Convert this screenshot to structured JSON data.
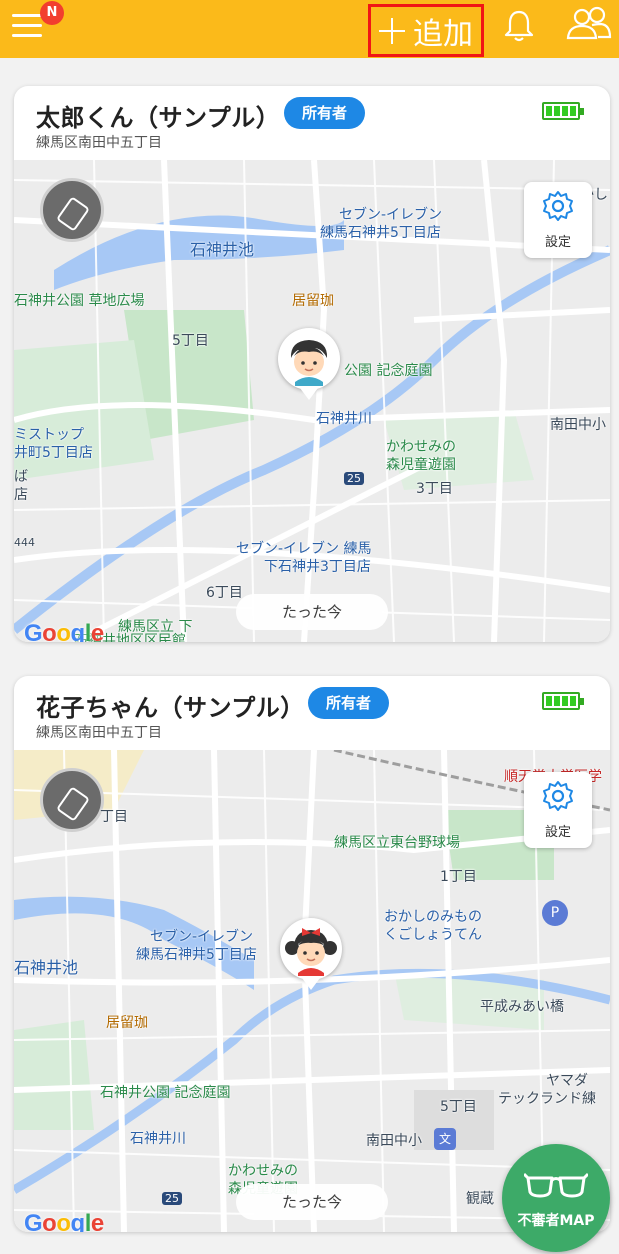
{
  "header": {
    "menu_badge": "N",
    "add_label": "追加",
    "colors": {
      "bar": "#FBBA1A",
      "highlight_box": "#F11515"
    }
  },
  "cards": [
    {
      "name": "太郎くん（サンプル）",
      "owner_badge": "所有者",
      "address": "練馬区南田中五丁目",
      "battery_level": 1.0,
      "settings_label": "設定",
      "time_label": "たった今",
      "avatar": "boy-avatar",
      "map_labels": {
        "seven1": "セブン-イレブン",
        "seven1b": "練馬石神井5丁目店",
        "ike": "石神井池",
        "park": "石神井公園 草地広場",
        "cafe": "居留珈",
        "chome5": "5丁目",
        "kinen": "公園 記念庭園",
        "river": "石神井川",
        "minamitanaka": "南田中小",
        "stop1": "ミストップ",
        "stop2": "井町5丁目店",
        "kawasemi1": "かわせみの",
        "kawasemi2": "森児童遊園",
        "chome3": "3丁目",
        "route25": "25",
        "seven2a": "セブン-イレブン 練馬",
        "seven2b": "下石神井3丁目店",
        "chome6": "6丁目",
        "nerima1": "練馬区立 下",
        "nerima2": "石神井地区区民館",
        "kashi": "かし",
        "route44": "444",
        "ba": "ば",
        "ten": "店"
      }
    },
    {
      "name": "花子ちゃん（サンプル）",
      "owner_badge": "所有者",
      "address": "練馬区南田中五丁目",
      "battery_level": 1.0,
      "settings_label": "設定",
      "time_label": "たった今",
      "avatar": "girl-avatar",
      "map_labels": {
        "juntendo": "順天堂大学医学",
        "chome_t": "丁目",
        "baseball": "練馬区立東台野球場",
        "chome1": "1丁目",
        "okashi1": "おかしのみもの",
        "okashi2": "くごしょうてん",
        "seven1": "セブン-イレブン",
        "seven1b": "練馬石神井5丁目店",
        "ike": "石神井池",
        "heisei": "平成みあい橋",
        "cafe": "居留珈",
        "kinen": "石神井公園 記念庭園",
        "yamada1": "ヤマダ",
        "yamada2": "テックランド練",
        "chome5": "5丁目",
        "river": "石神井川",
        "minamitanaka": "南田中小",
        "kawasemi1": "かわせみの",
        "kawasemi2": "森児童遊園",
        "kanzou": "観蔵",
        "route25": "25",
        "bunmark": "文",
        "parking": "P"
      }
    }
  ],
  "google_logo": "Google",
  "fab_label": "不審者MAP"
}
